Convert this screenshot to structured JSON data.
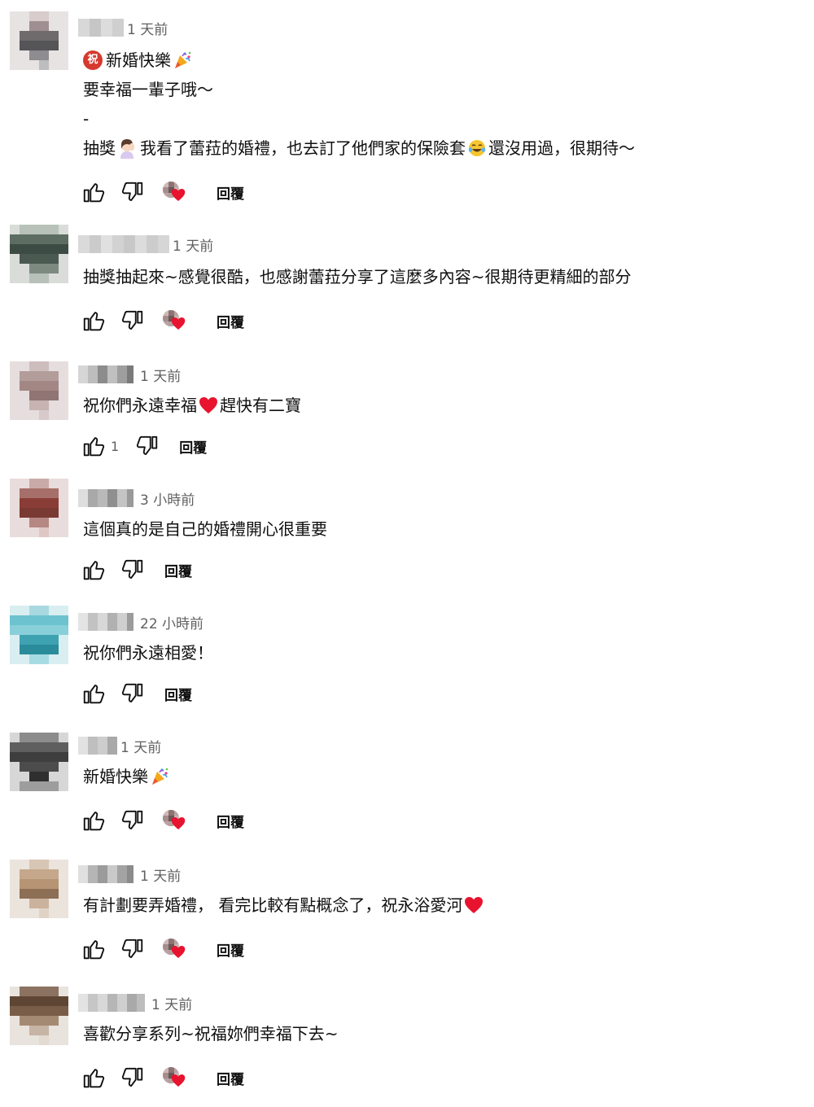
{
  "comments": [
    {
      "time": "1 天前",
      "lines": [
        "新婚快樂",
        "要幸福一輩子哦～",
        "-",
        "抽獎",
        "我看了蕾菈的婚禮，也去訂了他們家的保險套",
        "還沒用過，很期待～"
      ],
      "zhu_badge": "祝",
      "likes": "",
      "reply": "回覆"
    },
    {
      "time": "1 天前",
      "lines": [
        "抽獎抽起來~感覺很酷，也感謝蕾菈分享了這麼多內容~很期待更精細的部分"
      ],
      "likes": "",
      "reply": "回覆"
    },
    {
      "time": "1 天前",
      "lines": [
        "祝你們永遠幸福",
        "趕快有二寶"
      ],
      "likes": "1",
      "reply": "回覆"
    },
    {
      "time": "3 小時前",
      "lines": [
        "這個真的是自己的婚禮開心很重要"
      ],
      "likes": "",
      "reply": "回覆"
    },
    {
      "time": "22 小時前",
      "lines": [
        "祝你們永遠相愛！"
      ],
      "likes": "",
      "reply": "回覆"
    },
    {
      "time": "1 天前",
      "lines": [
        "新婚快樂"
      ],
      "likes": "",
      "reply": "回覆"
    },
    {
      "time": "1 天前",
      "lines": [
        "有計劃要弄婚禮， 看完比較有點概念了，祝永浴愛河"
      ],
      "likes": "",
      "reply": "回覆"
    },
    {
      "time": "1 天前",
      "lines": [
        "喜歡分享系列~祝福妳們幸福下去~"
      ],
      "likes": "",
      "reply": "回覆"
    }
  ],
  "icons": {
    "like": "thumbs-up-icon",
    "dislike": "thumbs-down-icon",
    "creator_heart": "creator-heart-icon",
    "party": "party-popper-icon",
    "heart": "red-heart-icon",
    "facepalm": "woman-facepalming-icon",
    "laugh": "tears-of-joy-icon"
  },
  "colors": {
    "text": "#0f0f0f",
    "secondary_text": "#606060",
    "heart": "#e8132f",
    "zhu_badge": "#d6392f"
  }
}
